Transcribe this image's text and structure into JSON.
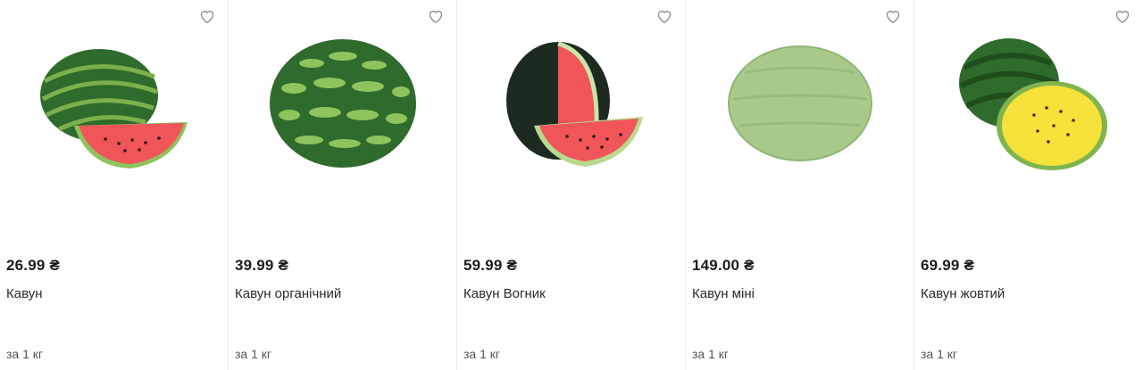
{
  "products": [
    {
      "price": "26.99 ₴",
      "name": "Кавун",
      "unit": "за 1 кг",
      "image_icon": "watermelon-with-slice-icon",
      "favorite_icon": "heart-outline-icon"
    },
    {
      "price": "39.99 ₴",
      "name": "Кавун органічний",
      "unit": "за 1 кг",
      "image_icon": "striped-watermelon-icon",
      "favorite_icon": "heart-outline-icon"
    },
    {
      "price": "59.99 ₴",
      "name": "Кавун Вогник",
      "unit": "за 1 кг",
      "image_icon": "dark-watermelon-cut-icon",
      "favorite_icon": "heart-outline-icon"
    },
    {
      "price": "149.00 ₴",
      "name": "Кавун міні",
      "unit": "за 1 кг",
      "image_icon": "light-green-watermelon-icon",
      "favorite_icon": "heart-outline-icon"
    },
    {
      "price": "69.99 ₴",
      "name": "Кавун жовтий",
      "unit": "за 1 кг",
      "image_icon": "yellow-watermelon-icon",
      "favorite_icon": "heart-outline-icon"
    }
  ],
  "colors": {
    "rind_dark": "#2f6b2c",
    "rind_stripe": "#1f4d1d",
    "flesh_red": "#f0555a",
    "flesh_yellow": "#f6e23a",
    "light_melon": "#a9c98a"
  }
}
